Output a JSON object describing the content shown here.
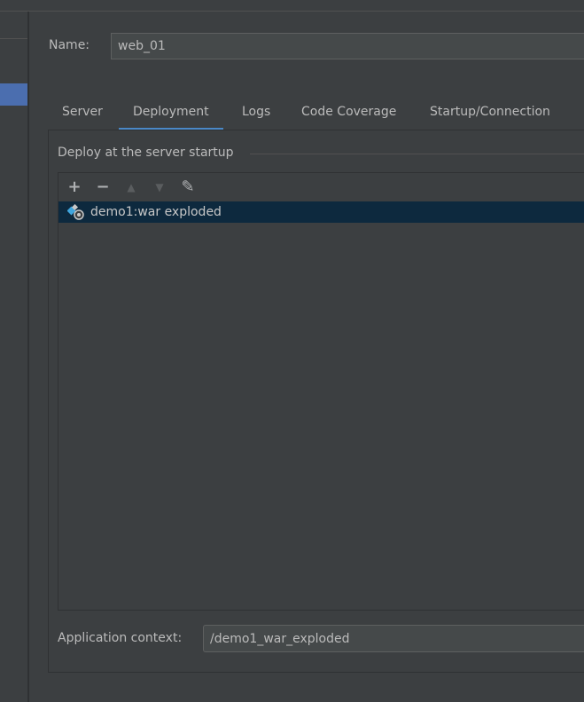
{
  "name": {
    "label": "Name:",
    "value": "web_01"
  },
  "tabs": [
    {
      "label": "Server"
    },
    {
      "label": "Deployment",
      "active": true
    },
    {
      "label": "Logs"
    },
    {
      "label": "Code Coverage"
    },
    {
      "label": "Startup/Connection"
    }
  ],
  "deploy": {
    "group_label": "Deploy at the server startup",
    "toolbar": {
      "add": "+",
      "remove": "−",
      "up": "▲",
      "down": "▼",
      "edit": "✎"
    },
    "items": [
      {
        "label": "demo1:war exploded",
        "icon": "artifact-web-icon",
        "selected": true
      }
    ]
  },
  "context": {
    "label": "Application context:",
    "value": "/demo1_war_exploded"
  },
  "colors": {
    "accent": "#4a88c7",
    "selection": "#0d293e",
    "sidebar_selection": "#4b6eaf"
  }
}
